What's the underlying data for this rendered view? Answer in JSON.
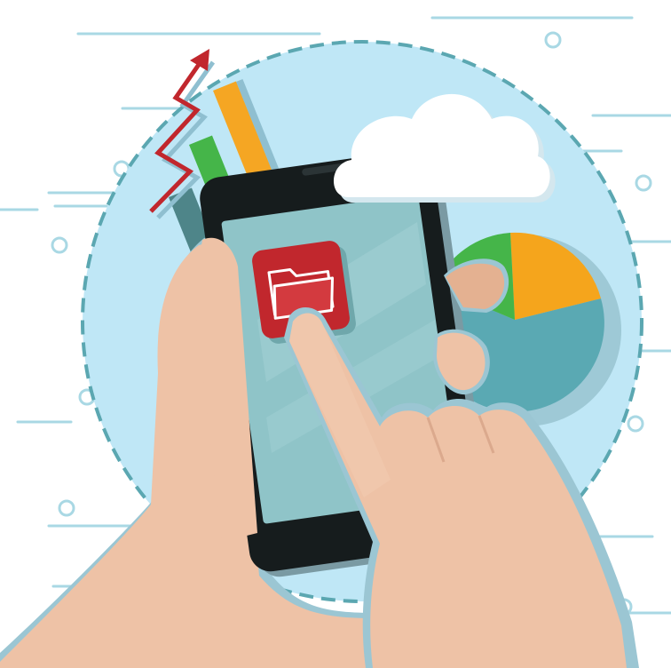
{
  "illustration": {
    "subject": "hands-holding-smartphone-tapping-folder-app",
    "colors": {
      "background": "#ffffff",
      "circle_fill": "#bfe7f6",
      "circle_dash": "#5ba7b1",
      "deco_lines": "#a9d8e4",
      "phone_body": "#161c1d",
      "phone_screen": "#8fc4c8",
      "app_icon_red": "#c1272d",
      "skin": "#eec2a6",
      "skin_shadow": "#dba98d",
      "skin_outline": "#9bc6d3",
      "cloud": "#ffffff",
      "bar_teal": "#4e8589",
      "bar_green": "#45b549",
      "bar_orange": "#f5a623",
      "pie_teal": "#5aa9b3",
      "pie_orange": "#f5a51c",
      "pie_green": "#45b549",
      "arrow_red": "#c1272d"
    },
    "icons": [
      "folder-icon",
      "cloud-icon",
      "trend-arrow-icon",
      "pie-chart-icon",
      "bar-chart-icon"
    ]
  }
}
